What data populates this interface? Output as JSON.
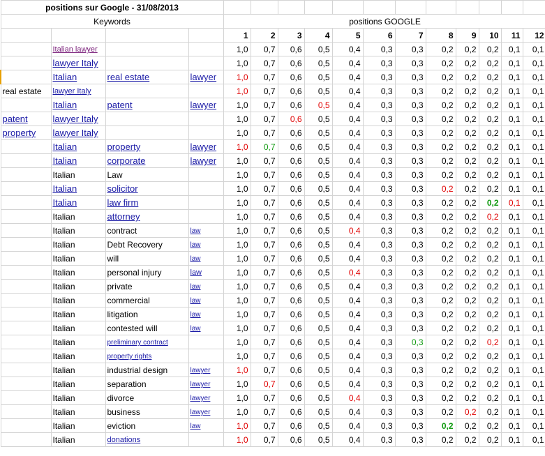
{
  "title": "positions sur Google - 31/08/2013",
  "headers": {
    "keywords": "Keywords",
    "positions": "positions GOOGLE"
  },
  "positions": [
    "1",
    "2",
    "3",
    "4",
    "5",
    "6",
    "7",
    "8",
    "9",
    "10",
    "11",
    "12"
  ],
  "base_values": [
    "1,0",
    "0,7",
    "0,6",
    "0,5",
    "0,4",
    "0,3",
    "0,3",
    "0,2",
    "0,2",
    "0,2",
    "0,1",
    "0,1"
  ],
  "colors": {
    "link": "#1a1aa6",
    "visited_link": "#7a1f7a",
    "red": "#e00000",
    "green": "#109a10",
    "grid": "#d4d4d4"
  },
  "rows": [
    {
      "a": "",
      "b": "Italian lawyer",
      "bL": "s2p",
      "c": "",
      "cL": "",
      "d": "",
      "dL": "",
      "vals": [
        "1,0",
        "0,7",
        "0,6",
        "0,5",
        "0,4",
        "0,3",
        "0,3",
        "0,2",
        "0,2",
        "0,2",
        "0,1",
        "0,1"
      ],
      "col": {}
    },
    {
      "a": "",
      "b": "lawyer Italy",
      "bL": "l1",
      "c": "",
      "cL": "",
      "d": "",
      "dL": "",
      "vals": [
        "1,0",
        "0,7",
        "0,6",
        "0,5",
        "0,4",
        "0,3",
        "0,3",
        "0,2",
        "0,2",
        "0,2",
        "0,1",
        "0,1"
      ],
      "col": {}
    },
    {
      "a": "",
      "b": "Italian",
      "bL": "l1",
      "c": "real estate",
      "cL": "l1",
      "d": "lawyer",
      "dL": "l1",
      "vals": [
        "1,0",
        "0,7",
        "0,6",
        "0,5",
        "0,4",
        "0,3",
        "0,3",
        "0,2",
        "0,2",
        "0,2",
        "0,1",
        "0,1"
      ],
      "col": {
        "0": "red"
      },
      "bar": true
    },
    {
      "a": "real estate",
      "aL": "",
      "b": "lawyer Italy",
      "bL": "s2",
      "c": "",
      "cL": "",
      "d": "",
      "dL": "",
      "vals": [
        "1,0",
        "0,7",
        "0,6",
        "0,5",
        "0,4",
        "0,3",
        "0,3",
        "0,2",
        "0,2",
        "0,2",
        "0,1",
        "0,1"
      ],
      "col": {
        "0": "red"
      }
    },
    {
      "a": "",
      "b": "Italian",
      "bL": "l1",
      "c": "patent",
      "cL": "l1",
      "d": "lawyer",
      "dL": "l1",
      "vals": [
        "1,0",
        "0,7",
        "0,6",
        "0,5",
        "0,4",
        "0,3",
        "0,3",
        "0,2",
        "0,2",
        "0,2",
        "0,1",
        "0,1"
      ],
      "col": {
        "3": "red"
      }
    },
    {
      "a": "patent",
      "aL": "l1",
      "b": "lawyer Italy",
      "bL": "l1",
      "c": "",
      "cL": "",
      "d": "",
      "dL": "",
      "vals": [
        "1,0",
        "0,7",
        "0,6",
        "0,5",
        "0,4",
        "0,3",
        "0,3",
        "0,2",
        "0,2",
        "0,2",
        "0,1",
        "0,1"
      ],
      "col": {
        "2": "red"
      }
    },
    {
      "a": "property",
      "aL": "l1",
      "b": "lawyer Italy",
      "bL": "l1",
      "c": "",
      "cL": "",
      "d": "",
      "dL": "",
      "vals": [
        "1,0",
        "0,7",
        "0,6",
        "0,5",
        "0,4",
        "0,3",
        "0,3",
        "0,2",
        "0,2",
        "0,2",
        "0,1",
        "0,1"
      ],
      "col": {}
    },
    {
      "a": "",
      "b": "Italian",
      "bL": "l1",
      "c": "property",
      "cL": "l1",
      "d": "lawyer",
      "dL": "l1",
      "vals": [
        "1,0",
        "0,7",
        "0,6",
        "0,5",
        "0,4",
        "0,3",
        "0,3",
        "0,2",
        "0,2",
        "0,2",
        "0,1",
        "0,1"
      ],
      "col": {
        "0": "red",
        "1": "green"
      }
    },
    {
      "a": "",
      "b": "Italian",
      "bL": "l1",
      "c": "corporate",
      "cL": "l1",
      "d": "lawyer",
      "dL": "l1",
      "vals": [
        "1,0",
        "0,7",
        "0,6",
        "0,5",
        "0,4",
        "0,3",
        "0,3",
        "0,2",
        "0,2",
        "0,2",
        "0,1",
        "0,1"
      ],
      "col": {}
    },
    {
      "a": "",
      "b": "Italian",
      "bL": "",
      "c": "Law",
      "cL": "",
      "d": "",
      "dL": "",
      "vals": [
        "1,0",
        "0,7",
        "0,6",
        "0,5",
        "0,4",
        "0,3",
        "0,3",
        "0,2",
        "0,2",
        "0,2",
        "0,1",
        "0,1"
      ],
      "col": {}
    },
    {
      "a": "",
      "b": "Italian",
      "bL": "l1",
      "c": "solicitor",
      "cL": "l1",
      "d": "",
      "dL": "",
      "vals": [
        "1,0",
        "0,7",
        "0,6",
        "0,5",
        "0,4",
        "0,3",
        "0,3",
        "0,2",
        "0,2",
        "0,2",
        "0,1",
        "0,1"
      ],
      "col": {
        "7": "red"
      }
    },
    {
      "a": "",
      "b": "Italian",
      "bL": "l1",
      "c": "law firm",
      "cL": "l1",
      "d": "",
      "dL": "",
      "vals": [
        "1,0",
        "0,7",
        "0,6",
        "0,5",
        "0,4",
        "0,3",
        "0,3",
        "0,2",
        "0,2",
        "0,2",
        "0,1",
        "0,1"
      ],
      "col": {
        "9": "greenb",
        "10": "red"
      }
    },
    {
      "a": "",
      "b": "Italian",
      "bL": "",
      "c": "attorney",
      "cL": "l1",
      "d": "",
      "dL": "",
      "vals": [
        "1,0",
        "0,7",
        "0,6",
        "0,5",
        "0,4",
        "0,3",
        "0,3",
        "0,2",
        "0,2",
        "0,2",
        "0,1",
        "0,1"
      ],
      "col": {
        "9": "red"
      }
    },
    {
      "a": "",
      "b": "Italian",
      "bL": "",
      "c": "contract",
      "cL": "",
      "d": "law",
      "dL": "s3",
      "vals": [
        "1,0",
        "0,7",
        "0,6",
        "0,5",
        "0,4",
        "0,3",
        "0,3",
        "0,2",
        "0,2",
        "0,2",
        "0,1",
        "0,1"
      ],
      "col": {
        "4": "red"
      }
    },
    {
      "a": "",
      "b": "Italian",
      "bL": "",
      "c": "Debt Recovery",
      "cL": "",
      "d": "law",
      "dL": "s3",
      "vals": [
        "1,0",
        "0,7",
        "0,6",
        "0,5",
        "0,4",
        "0,3",
        "0,3",
        "0,2",
        "0,2",
        "0,2",
        "0,1",
        "0,1"
      ],
      "col": {}
    },
    {
      "a": "",
      "b": "Italian",
      "bL": "",
      "c": "will",
      "cL": "",
      "d": "law",
      "dL": "s3",
      "vals": [
        "1,0",
        "0,7",
        "0,6",
        "0,5",
        "0,4",
        "0,3",
        "0,3",
        "0,2",
        "0,2",
        "0,2",
        "0,1",
        "0,1"
      ],
      "col": {}
    },
    {
      "a": "",
      "b": "Italian",
      "bL": "",
      "c": "personal injury",
      "cL": "",
      "d": "law",
      "dL": "s2",
      "vals": [
        "1,0",
        "0,7",
        "0,6",
        "0,5",
        "0,4",
        "0,3",
        "0,3",
        "0,2",
        "0,2",
        "0,2",
        "0,1",
        "0,1"
      ],
      "col": {
        "4": "red"
      }
    },
    {
      "a": "",
      "b": "Italian",
      "bL": "",
      "c": "private",
      "cL": "",
      "d": "law",
      "dL": "s3",
      "vals": [
        "1,0",
        "0,7",
        "0,6",
        "0,5",
        "0,4",
        "0,3",
        "0,3",
        "0,2",
        "0,2",
        "0,2",
        "0,1",
        "0,1"
      ],
      "col": {}
    },
    {
      "a": "",
      "b": "Italian",
      "bL": "",
      "c": "commercial",
      "cL": "",
      "d": "law",
      "dL": "s3",
      "vals": [
        "1,0",
        "0,7",
        "0,6",
        "0,5",
        "0,4",
        "0,3",
        "0,3",
        "0,2",
        "0,2",
        "0,2",
        "0,1",
        "0,1"
      ],
      "col": {}
    },
    {
      "a": "",
      "b": "Italian",
      "bL": "",
      "c": "litigation",
      "cL": "",
      "d": "law",
      "dL": "s3",
      "vals": [
        "1,0",
        "0,7",
        "0,6",
        "0,5",
        "0,4",
        "0,3",
        "0,3",
        "0,2",
        "0,2",
        "0,2",
        "0,1",
        "0,1"
      ],
      "col": {}
    },
    {
      "a": "",
      "b": "Italian",
      "bL": "",
      "c": "contested will",
      "cL": "",
      "d": "law",
      "dL": "s3",
      "vals": [
        "1,0",
        "0,7",
        "0,6",
        "0,5",
        "0,4",
        "0,3",
        "0,3",
        "0,2",
        "0,2",
        "0,2",
        "0,1",
        "0,1"
      ],
      "col": {}
    },
    {
      "a": "",
      "b": "Italian",
      "bL": "",
      "c": "preliminary contract",
      "cL": "s3",
      "d": "",
      "dL": "",
      "vals": [
        "1,0",
        "0,7",
        "0,6",
        "0,5",
        "0,4",
        "0,3",
        "0,3",
        "0,2",
        "0,2",
        "0,2",
        "0,1",
        "0,1"
      ],
      "col": {
        "6": "green",
        "9": "red"
      }
    },
    {
      "a": "",
      "b": "Italian",
      "bL": "",
      "c": "property rights",
      "cL": "s3",
      "d": "",
      "dL": "",
      "vals": [
        "1,0",
        "0,7",
        "0,6",
        "0,5",
        "0,4",
        "0,3",
        "0,3",
        "0,2",
        "0,2",
        "0,2",
        "0,1",
        "0,1"
      ],
      "col": {}
    },
    {
      "a": "",
      "b": "Italian",
      "bL": "",
      "c": "industrial design",
      "cL": "",
      "d": "lawyer",
      "dL": "s3",
      "vals": [
        "1,0",
        "0,7",
        "0,6",
        "0,5",
        "0,4",
        "0,3",
        "0,3",
        "0,2",
        "0,2",
        "0,2",
        "0,1",
        "0,1"
      ],
      "col": {
        "0": "red"
      }
    },
    {
      "a": "",
      "b": "Italian",
      "bL": "",
      "c": "separation",
      "cL": "",
      "d": "lawyer",
      "dL": "s3",
      "vals": [
        "1,0",
        "0,7",
        "0,6",
        "0,5",
        "0,4",
        "0,3",
        "0,3",
        "0,2",
        "0,2",
        "0,2",
        "0,1",
        "0,1"
      ],
      "col": {
        "1": "red"
      }
    },
    {
      "a": "",
      "b": "Italian",
      "bL": "",
      "c": "divorce",
      "cL": "",
      "d": "lawyer",
      "dL": "s3",
      "vals": [
        "1,0",
        "0,7",
        "0,6",
        "0,5",
        "0,4",
        "0,3",
        "0,3",
        "0,2",
        "0,2",
        "0,2",
        "0,1",
        "0,1"
      ],
      "col": {
        "4": "red"
      }
    },
    {
      "a": "",
      "b": "Italian",
      "bL": "",
      "c": "business",
      "cL": "",
      "d": "lawyer",
      "dL": "s3",
      "vals": [
        "1,0",
        "0,7",
        "0,6",
        "0,5",
        "0,4",
        "0,3",
        "0,3",
        "0,2",
        "0,2",
        "0,2",
        "0,1",
        "0,1"
      ],
      "col": {
        "8": "red"
      }
    },
    {
      "a": "",
      "b": "Italian",
      "bL": "",
      "c": "eviction",
      "cL": "",
      "d": "law",
      "dL": "s3",
      "vals": [
        "1,0",
        "0,7",
        "0,6",
        "0,5",
        "0,4",
        "0,3",
        "0,3",
        "0,2",
        "0,2",
        "0,2",
        "0,1",
        "0,1"
      ],
      "col": {
        "0": "red",
        "7": "greenb"
      }
    },
    {
      "a": "",
      "b": "Italian",
      "bL": "",
      "c": "donations",
      "cL": "s2",
      "d": "",
      "dL": "",
      "vals": [
        "1,0",
        "0,7",
        "0,6",
        "0,5",
        "0,4",
        "0,3",
        "0,3",
        "0,2",
        "0,2",
        "0,2",
        "0,1",
        "0,1"
      ],
      "col": {
        "0": "red"
      }
    }
  ]
}
